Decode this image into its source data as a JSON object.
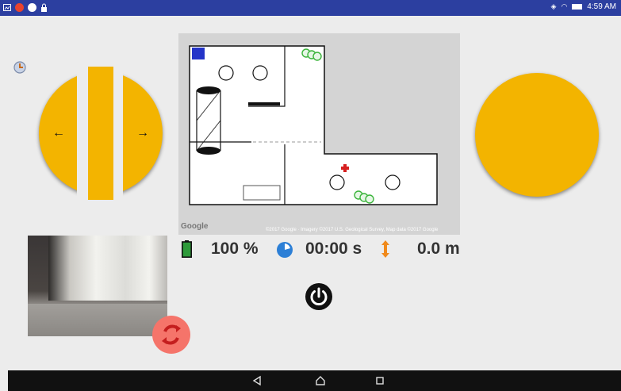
{
  "status_bar": {
    "time": "4:59 AM",
    "background": "#2c3fa0"
  },
  "map": {
    "attribution_logo": "Google",
    "copyright": "©2017 Google · Imagery ©2017 U.S. Geological Survey, Map data ©2017 Google"
  },
  "stats": {
    "battery_level": "100 %",
    "timer": "00:00 s",
    "distance": "0.0 m"
  },
  "colors": {
    "joystick": "#f3b400",
    "battery": "#2e9a3a",
    "timer": "#2c7fd6",
    "distance": "#f08a1c",
    "switch_camera": "#f5746a",
    "robot_marker": "#d62020",
    "plants": "#3cb43c"
  },
  "icons": {
    "joystick_arrows": [
      "←",
      "→"
    ],
    "nav": [
      "back-triangle-icon",
      "home-circle-icon",
      "recents-square-icon"
    ]
  }
}
